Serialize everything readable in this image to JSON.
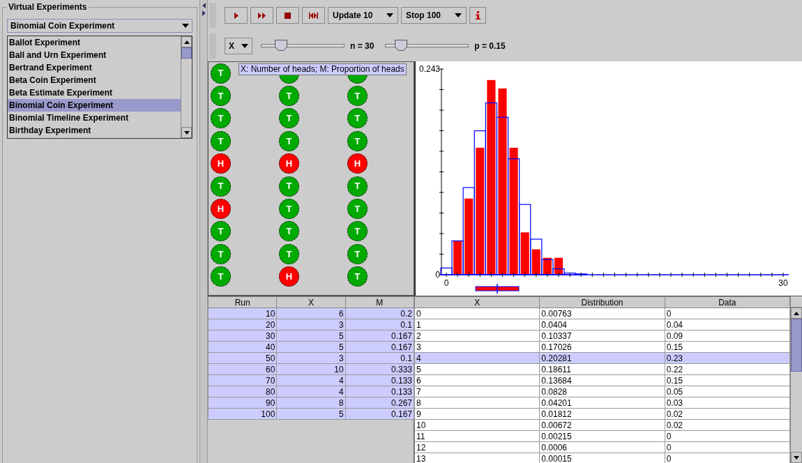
{
  "left_panel": {
    "title": "Virtual Experiments",
    "combo": {
      "value": "Binomial Coin Experiment"
    },
    "list": [
      {
        "label": "Ballot Experiment",
        "selected": false
      },
      {
        "label": "Ball and Urn Experiment",
        "selected": false
      },
      {
        "label": "Bertrand Experiment",
        "selected": false
      },
      {
        "label": "Beta Coin Experiment",
        "selected": false
      },
      {
        "label": "Beta Estimate Experiment",
        "selected": false
      },
      {
        "label": "Binomial Coin Experiment",
        "selected": true
      },
      {
        "label": "Binomial Timeline Experiment",
        "selected": false
      },
      {
        "label": "Birthday Experiment",
        "selected": false
      }
    ]
  },
  "toolbar": {
    "controls": [
      {
        "kind": "play"
      },
      {
        "kind": "fast_forward"
      },
      {
        "kind": "stop"
      },
      {
        "kind": "reset"
      },
      {
        "kind": "combo",
        "value": "Update 10"
      },
      {
        "kind": "combo",
        "value": "Stop 100"
      },
      {
        "kind": "info"
      }
    ],
    "variable": {
      "value": "X"
    },
    "sliders": [
      {
        "label": "n = 30",
        "level": 0.2
      },
      {
        "label": "p = 0.15",
        "level": 0.13
      }
    ]
  },
  "coins": {
    "columns": [
      [
        {
          "heads": false,
          "label": "T"
        },
        {
          "heads": false,
          "label": "T"
        },
        {
          "heads": false,
          "label": "T"
        },
        {
          "heads": false,
          "label": "T"
        },
        {
          "heads": true,
          "label": "H"
        },
        {
          "heads": false,
          "label": "T"
        },
        {
          "heads": true,
          "label": "H"
        },
        {
          "heads": false,
          "label": "T"
        },
        {
          "heads": false,
          "label": "T"
        },
        {
          "heads": false,
          "label": "T"
        }
      ],
      [
        {
          "heads": false
        },
        {
          "heads": false,
          "label": "T"
        },
        {
          "heads": false,
          "label": "T"
        },
        {
          "heads": false,
          "label": "T"
        },
        {
          "heads": true,
          "label": "H"
        },
        {
          "heads": false,
          "label": "T"
        },
        {
          "heads": false,
          "label": "T"
        },
        {
          "heads": false,
          "label": "T"
        },
        {
          "heads": false,
          "label": "T"
        },
        {
          "heads": true,
          "label": "H"
        }
      ],
      [
        {
          "heads": false
        },
        {
          "heads": false,
          "label": "T"
        },
        {
          "heads": false,
          "label": "T"
        },
        {
          "heads": false,
          "label": "T"
        },
        {
          "heads": true,
          "label": "H"
        },
        {
          "heads": false,
          "label": "T"
        },
        {
          "heads": false,
          "label": "T"
        },
        {
          "heads": false,
          "label": "T"
        },
        {
          "heads": false,
          "label": "T"
        },
        {
          "heads": false,
          "label": "T"
        }
      ]
    ]
  },
  "tooltip": "X: Number of heads; M: Proportion of heads",
  "chart_data": {
    "type": "bar",
    "x": [
      0,
      1,
      2,
      3,
      4,
      5,
      6,
      7,
      8,
      9,
      10,
      11,
      12,
      13,
      14,
      15,
      16,
      17,
      18,
      19,
      20,
      21,
      22,
      23,
      24,
      25,
      26,
      27,
      28,
      29,
      30
    ],
    "series": [
      {
        "color": "#ff0000",
        "values": [
          0,
          0.04,
          0.09,
          0.15,
          0.23,
          0.22,
          0.15,
          0.05,
          0.03,
          0.02,
          0.02,
          0,
          0,
          0,
          0,
          0,
          0,
          0,
          0,
          0,
          0,
          0,
          0,
          0,
          0,
          0,
          0,
          0,
          0,
          0,
          0
        ]
      },
      {
        "color": "#0000ff",
        "values": [
          0.008,
          0.04,
          0.103,
          0.17,
          0.203,
          0.186,
          0.137,
          0.083,
          0.042,
          0.018,
          0.007,
          0.002,
          0.001,
          0,
          0,
          0,
          0,
          0,
          0,
          0,
          0,
          0,
          0,
          0,
          0,
          0,
          0,
          0,
          0,
          0,
          0
        ]
      }
    ],
    "xlim": [
      -0.5,
      30.5
    ],
    "ylim": [
      0,
      0.243
    ],
    "xticks": [
      0,
      30
    ],
    "yticks": [
      0,
      0.243
    ]
  },
  "run_table": {
    "columns": [
      "Run",
      "X",
      "M"
    ],
    "rows": [
      [
        "10",
        "6",
        "0.2"
      ],
      [
        "20",
        "3",
        "0.1"
      ],
      [
        "30",
        "5",
        "0.167"
      ],
      [
        "40",
        "5",
        "0.167"
      ],
      [
        "50",
        "3",
        "0.1"
      ],
      [
        "60",
        "10",
        "0.333"
      ],
      [
        "70",
        "4",
        "0.133"
      ],
      [
        "80",
        "4",
        "0.133"
      ],
      [
        "90",
        "8",
        "0.267"
      ],
      [
        "100",
        "5",
        "0.167"
      ]
    ]
  },
  "distribution_table": {
    "columns": [
      "X",
      "Distribution",
      "Data"
    ],
    "rows": [
      {
        "cells": [
          "0",
          "0.00763",
          "0"
        ],
        "selected": false
      },
      {
        "cells": [
          "1",
          "0.0404",
          "0.04"
        ],
        "selected": false
      },
      {
        "cells": [
          "2",
          "0.10337",
          "0.09"
        ],
        "selected": false
      },
      {
        "cells": [
          "3",
          "0.17026",
          "0.15"
        ],
        "selected": false
      },
      {
        "cells": [
          "4",
          "0.20281",
          "0.23"
        ],
        "selected": true
      },
      {
        "cells": [
          "5",
          "0.18611",
          "0.22"
        ],
        "selected": false
      },
      {
        "cells": [
          "6",
          "0.13684",
          "0.15"
        ],
        "selected": false
      },
      {
        "cells": [
          "7",
          "0.0828",
          "0.05"
        ],
        "selected": false
      },
      {
        "cells": [
          "8",
          "0.04201",
          "0.03"
        ],
        "selected": false
      },
      {
        "cells": [
          "9",
          "0.01812",
          "0.02"
        ],
        "selected": false
      },
      {
        "cells": [
          "10",
          "0.00672",
          "0.02"
        ],
        "selected": false
      },
      {
        "cells": [
          "11",
          "0.00215",
          "0"
        ],
        "selected": false
      },
      {
        "cells": [
          "12",
          "0.0006",
          "0"
        ],
        "selected": false
      },
      {
        "cells": [
          "13",
          "0.00015",
          "0"
        ],
        "selected": false
      }
    ]
  }
}
